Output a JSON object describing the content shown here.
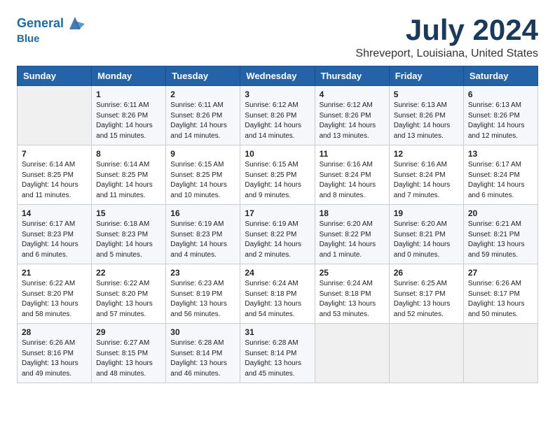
{
  "header": {
    "logo_line1": "General",
    "logo_line2": "Blue",
    "month_year": "July 2024",
    "location": "Shreveport, Louisiana, United States"
  },
  "days_of_week": [
    "Sunday",
    "Monday",
    "Tuesday",
    "Wednesday",
    "Thursday",
    "Friday",
    "Saturday"
  ],
  "weeks": [
    [
      {
        "day": "",
        "info": ""
      },
      {
        "day": "1",
        "info": "Sunrise: 6:11 AM\nSunset: 8:26 PM\nDaylight: 14 hours and 15 minutes."
      },
      {
        "day": "2",
        "info": "Sunrise: 6:11 AM\nSunset: 8:26 PM\nDaylight: 14 hours and 14 minutes."
      },
      {
        "day": "3",
        "info": "Sunrise: 6:12 AM\nSunset: 8:26 PM\nDaylight: 14 hours and 14 minutes."
      },
      {
        "day": "4",
        "info": "Sunrise: 6:12 AM\nSunset: 8:26 PM\nDaylight: 14 hours and 13 minutes."
      },
      {
        "day": "5",
        "info": "Sunrise: 6:13 AM\nSunset: 8:26 PM\nDaylight: 14 hours and 13 minutes."
      },
      {
        "day": "6",
        "info": "Sunrise: 6:13 AM\nSunset: 8:26 PM\nDaylight: 14 hours and 12 minutes."
      }
    ],
    [
      {
        "day": "7",
        "info": "Sunrise: 6:14 AM\nSunset: 8:25 PM\nDaylight: 14 hours and 11 minutes."
      },
      {
        "day": "8",
        "info": "Sunrise: 6:14 AM\nSunset: 8:25 PM\nDaylight: 14 hours and 11 minutes."
      },
      {
        "day": "9",
        "info": "Sunrise: 6:15 AM\nSunset: 8:25 PM\nDaylight: 14 hours and 10 minutes."
      },
      {
        "day": "10",
        "info": "Sunrise: 6:15 AM\nSunset: 8:25 PM\nDaylight: 14 hours and 9 minutes."
      },
      {
        "day": "11",
        "info": "Sunrise: 6:16 AM\nSunset: 8:24 PM\nDaylight: 14 hours and 8 minutes."
      },
      {
        "day": "12",
        "info": "Sunrise: 6:16 AM\nSunset: 8:24 PM\nDaylight: 14 hours and 7 minutes."
      },
      {
        "day": "13",
        "info": "Sunrise: 6:17 AM\nSunset: 8:24 PM\nDaylight: 14 hours and 6 minutes."
      }
    ],
    [
      {
        "day": "14",
        "info": "Sunrise: 6:17 AM\nSunset: 8:23 PM\nDaylight: 14 hours and 6 minutes."
      },
      {
        "day": "15",
        "info": "Sunrise: 6:18 AM\nSunset: 8:23 PM\nDaylight: 14 hours and 5 minutes."
      },
      {
        "day": "16",
        "info": "Sunrise: 6:19 AM\nSunset: 8:23 PM\nDaylight: 14 hours and 4 minutes."
      },
      {
        "day": "17",
        "info": "Sunrise: 6:19 AM\nSunset: 8:22 PM\nDaylight: 14 hours and 2 minutes."
      },
      {
        "day": "18",
        "info": "Sunrise: 6:20 AM\nSunset: 8:22 PM\nDaylight: 14 hours and 1 minute."
      },
      {
        "day": "19",
        "info": "Sunrise: 6:20 AM\nSunset: 8:21 PM\nDaylight: 14 hours and 0 minutes."
      },
      {
        "day": "20",
        "info": "Sunrise: 6:21 AM\nSunset: 8:21 PM\nDaylight: 13 hours and 59 minutes."
      }
    ],
    [
      {
        "day": "21",
        "info": "Sunrise: 6:22 AM\nSunset: 8:20 PM\nDaylight: 13 hours and 58 minutes."
      },
      {
        "day": "22",
        "info": "Sunrise: 6:22 AM\nSunset: 8:20 PM\nDaylight: 13 hours and 57 minutes."
      },
      {
        "day": "23",
        "info": "Sunrise: 6:23 AM\nSunset: 8:19 PM\nDaylight: 13 hours and 56 minutes."
      },
      {
        "day": "24",
        "info": "Sunrise: 6:24 AM\nSunset: 8:18 PM\nDaylight: 13 hours and 54 minutes."
      },
      {
        "day": "25",
        "info": "Sunrise: 6:24 AM\nSunset: 8:18 PM\nDaylight: 13 hours and 53 minutes."
      },
      {
        "day": "26",
        "info": "Sunrise: 6:25 AM\nSunset: 8:17 PM\nDaylight: 13 hours and 52 minutes."
      },
      {
        "day": "27",
        "info": "Sunrise: 6:26 AM\nSunset: 8:17 PM\nDaylight: 13 hours and 50 minutes."
      }
    ],
    [
      {
        "day": "28",
        "info": "Sunrise: 6:26 AM\nSunset: 8:16 PM\nDaylight: 13 hours and 49 minutes."
      },
      {
        "day": "29",
        "info": "Sunrise: 6:27 AM\nSunset: 8:15 PM\nDaylight: 13 hours and 48 minutes."
      },
      {
        "day": "30",
        "info": "Sunrise: 6:28 AM\nSunset: 8:14 PM\nDaylight: 13 hours and 46 minutes."
      },
      {
        "day": "31",
        "info": "Sunrise: 6:28 AM\nSunset: 8:14 PM\nDaylight: 13 hours and 45 minutes."
      },
      {
        "day": "",
        "info": ""
      },
      {
        "day": "",
        "info": ""
      },
      {
        "day": "",
        "info": ""
      }
    ]
  ]
}
